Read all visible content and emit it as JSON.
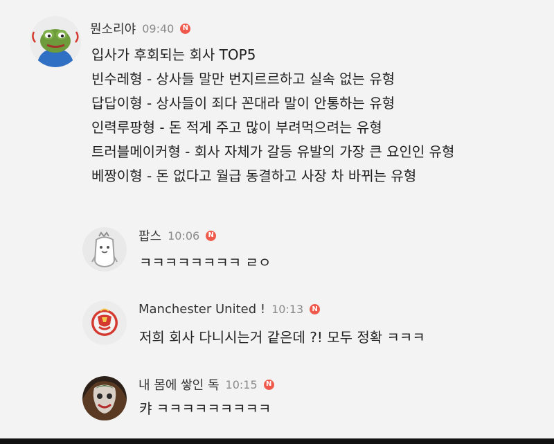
{
  "comments": [
    {
      "author": "뭔소리야",
      "time": "09:40",
      "badge": "N",
      "lines": [
        "입사가 후회되는 회사 TOP5",
        "빈수레형 - 상사들 말만 번지르르하고 실속 없는 유형",
        "답답이형 - 상사들이 죄다 꼰대라 말이 안통하는 유형",
        "인력루팡형 - 돈 적게 주고 많이 부려먹으려는 유형",
        "트러블메이커형 - 회사 자체가 갈등 유발의 가장 큰 요인인 유형",
        "베짱이형 - 돈 없다고 월급 동결하고 사장 차 바뀌는 유형"
      ],
      "avatar_icon": "frog-avatar-icon"
    },
    {
      "author": "팝스",
      "time": "10:06",
      "badge": "N",
      "text": "ㅋㅋㅋㅋㅋㅋㅋㅋ ㄹㅇ",
      "avatar_icon": "character-avatar-icon"
    },
    {
      "author": "Manchester United !",
      "time": "10:13",
      "badge": "N",
      "text": "저희 회사 다니시는거 같은데 ?! 모두 정확 ㅋㅋㅋ",
      "avatar_icon": "club-crest-avatar-icon"
    },
    {
      "author": "내 몸에 쌓인 독",
      "time": "10:15",
      "badge": "N",
      "text": "캬 ㅋㅋㅋㅋㅋㅋㅋㅋㅋ",
      "avatar_icon": "joker-avatar-icon"
    }
  ],
  "colors": {
    "background": "#f3f3f3",
    "badge": "#ef5a4d",
    "author": "#333333",
    "time": "#8a8a8a",
    "text": "#1f1f1f"
  }
}
